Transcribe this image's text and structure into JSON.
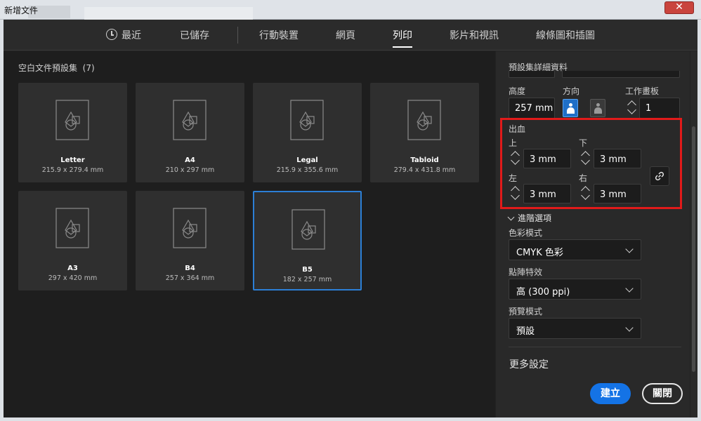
{
  "window": {
    "title": "新增文件",
    "close_symbol": "✕"
  },
  "tabs": [
    {
      "label": "最近",
      "icon": "clock-icon"
    },
    {
      "label": "已儲存"
    },
    {
      "label": "行動裝置"
    },
    {
      "label": "網頁"
    },
    {
      "label": "列印",
      "active": true
    },
    {
      "label": "影片和視訊"
    },
    {
      "label": "線條圖和插圖"
    }
  ],
  "presets": {
    "title": "空白文件預設集",
    "count": "(7)",
    "items": [
      {
        "name": "Letter",
        "size": "215.9 x 279.4 mm"
      },
      {
        "name": "A4",
        "size": "210 x 297 mm"
      },
      {
        "name": "Legal",
        "size": "215.9 x 355.6 mm"
      },
      {
        "name": "Tabloid",
        "size": "279.4 x 431.8 mm"
      },
      {
        "name": "A3",
        "size": "297 x 420 mm"
      },
      {
        "name": "B4",
        "size": "257 x 364 mm"
      },
      {
        "name": "B5",
        "size": "182 x 257 mm",
        "selected": true
      }
    ]
  },
  "details": {
    "section_label": "預設集詳細資料",
    "height_label": "高度",
    "height_value": "257 mm",
    "orientation_label": "方向",
    "artboards_label": "工作畫板",
    "artboards_value": "1",
    "bleed": {
      "label": "出血",
      "top_label": "上",
      "top_value": "3 mm",
      "bottom_label": "下",
      "bottom_value": "3 mm",
      "left_label": "左",
      "left_value": "3 mm",
      "right_label": "右",
      "right_value": "3 mm"
    },
    "advanced_label": "進階選項",
    "color_mode_label": "色彩模式",
    "color_mode_value": "CMYK 色彩",
    "raster_label": "點陣特效",
    "raster_value": "高 (300 ppi)",
    "preview_label": "預覽模式",
    "preview_value": "預設",
    "more_settings": "更多設定"
  },
  "buttons": {
    "create": "建立",
    "close": "關閉"
  },
  "colors": {
    "accent": "#1473e6",
    "highlight_box": "#e11a1a",
    "selected_border": "#2c7fd6"
  }
}
